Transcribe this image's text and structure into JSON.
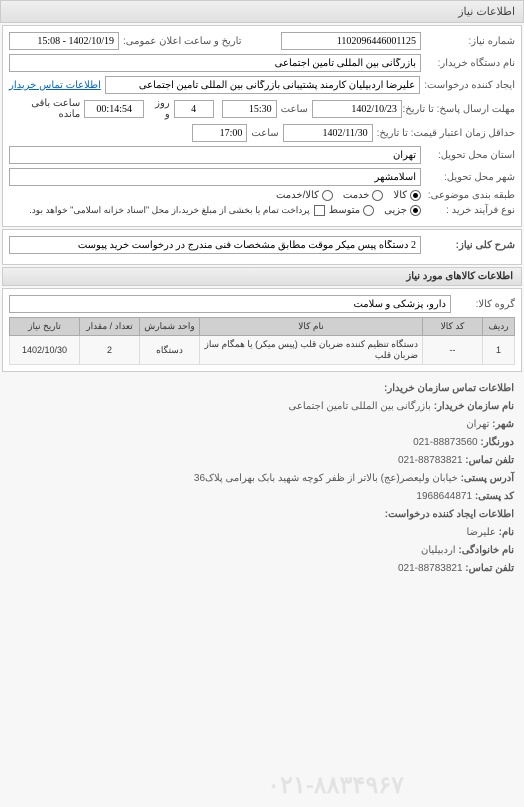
{
  "tab_title": "اطلاعات نیاز",
  "fields": {
    "need_number_label": "شماره نیاز:",
    "need_number": "1102096446001125",
    "announce_datetime_label": "تاریخ و ساعت اعلان عمومی:",
    "announce_datetime": "1402/10/19 - 15:08",
    "buyer_org_label": "نام دستگاه خریدار:",
    "buyer_org": "بازرگانی بین المللی تامین اجتماعی",
    "requester_label": "ایجاد کننده درخواست:",
    "requester": "علیرضا اردبیلیان کارمند پشتیبانی بازرگانی بین المللی تامین اجتماعی",
    "buyer_contact_link": "اطلاعات تماس خریدار",
    "response_deadline_label": "مهلت ارسال پاسخ: تا تاریخ:",
    "response_date": "1402/10/23",
    "response_time_label": "ساعت",
    "response_time": "15:30",
    "days_remain": "4",
    "days_remain_label": "روز و",
    "time_remain": "00:14:54",
    "time_remain_label": "ساعت باقی مانده",
    "min_delivery_label": "حداقل زمان اعتبار قیمت: تا تاریخ:",
    "min_delivery_date": "1402/11/30",
    "min_delivery_time_label": "ساعت",
    "min_delivery_time": "17:00",
    "delivery_state_label": "استان محل تحویل:",
    "delivery_state": "تهران",
    "delivery_city_label": "شهر محل تحویل:",
    "delivery_city": "اسلامشهر",
    "class_label": "طبقه بندی موضوعی:",
    "class_goods": "کالا",
    "class_service": "خدمت",
    "class_both": "کالا/خدمت",
    "buy_type_label": "نوع فرآیند خرید :",
    "buy_partial": "جزیی",
    "buy_medium": "متوسط",
    "buy_note": "پرداخت تمام یا بخشی از مبلغ خرید،از محل \"اسناد خزانه اسلامی\" خواهد بود.",
    "need_title_label": "شرح کلی نیاز:",
    "need_title": "2 دستگاه پیس میکر موقت مطابق مشخصات فنی مندرج در درخواست خرید پیوست"
  },
  "goods_section_title": "اطلاعات کالاهای مورد نیاز",
  "goods_group_label": "گروه کالا:",
  "goods_group": "دارو، پزشکی و سلامت",
  "table_headers": {
    "row": "ردیف",
    "code": "کد کالا",
    "name": "نام کالا",
    "unit": "واحد شمارش",
    "qty": "تعداد / مقدار",
    "date": "تاریخ نیاز"
  },
  "table_rows": [
    {
      "row": "1",
      "code": "--",
      "name": "دستگاه تنظیم کننده ضربان قلب (پیس میکر) یا همگام ساز ضربان قلب",
      "unit": "دستگاه",
      "qty": "2",
      "date": "1402/10/30"
    }
  ],
  "footer": {
    "contact_title": "اطلاعات تماس سازمان خریدار:",
    "org_label": "نام سازمان خریدار:",
    "org": "بازرگانی بین المللی تامین اجتماعی",
    "city_label": "شهر:",
    "city": "تهران",
    "fax_label": "دورنگار:",
    "fax": "88873560-021",
    "phone1_label": "تلفن تماس:",
    "phone1": "88783821-021",
    "address_label": "آدرس پستی:",
    "address": "خیابان ولیعصر(عج) بالاتر از ظفر کوچه شهید بابک بهرامی پلاک36",
    "postcode_label": "کد پستی:",
    "postcode": "1968644871",
    "req_contact_title": "اطلاعات ایجاد کننده درخواست:",
    "name_label": "نام:",
    "name": "علیرضا",
    "lname_label": "نام خانوادگی:",
    "lname": "اردبیلیان",
    "phone2_label": "تلفن تماس:",
    "phone2": "88783821-021"
  },
  "watermark": "۰۲۱-۸۸۳۴۹۶۷"
}
